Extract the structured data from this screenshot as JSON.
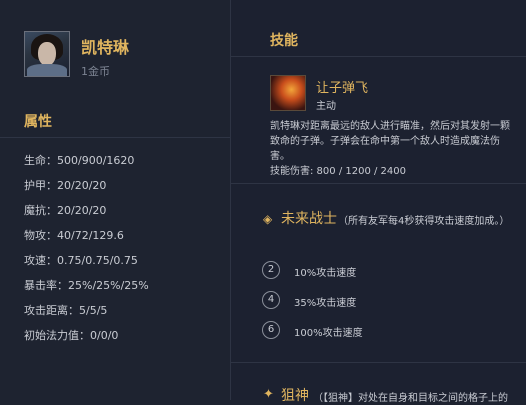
{
  "champion": {
    "name": "凯特琳",
    "cost": "1金币"
  },
  "stats": {
    "title": "属性",
    "items": [
      "生命：500/900/1620",
      "护甲：20/20/20",
      "魔抗：20/20/20",
      "物攻：40/72/129.6",
      "攻速：0.75/0.75/0.75",
      "暴击率：25%/25%/25%",
      "攻击距离：5/5/5",
      "初始法力值：0/0/0"
    ]
  },
  "skills": {
    "title": "技能",
    "skill": {
      "name": "让子弹飞",
      "type": "主动",
      "description": "凯特琳对距离最远的敌人进行瞄准，然后对其发射一颗致命的子弹。子弹会在命中第一个敌人时造成魔法伤害。",
      "damage": "技能伤害: 800 / 1200 / 2400"
    }
  },
  "trait": {
    "icon": "future-warrior-icon",
    "name": "未来战士",
    "description": "（所有友军每4秒获得攻击速度加成。）",
    "tiers": [
      {
        "count": "2",
        "text": "10%攻击速度"
      },
      {
        "count": "4",
        "text": "35%攻击速度"
      },
      {
        "count": "6",
        "text": "100%攻击速度"
      }
    ]
  },
  "trait2": {
    "icon": "sniper-icon",
    "name": "狙神",
    "description": "（【狙神】对处在自身和目标之间的格子上的"
  },
  "colors": {
    "accent": "#e0b55f",
    "background": "#1e2330"
  }
}
